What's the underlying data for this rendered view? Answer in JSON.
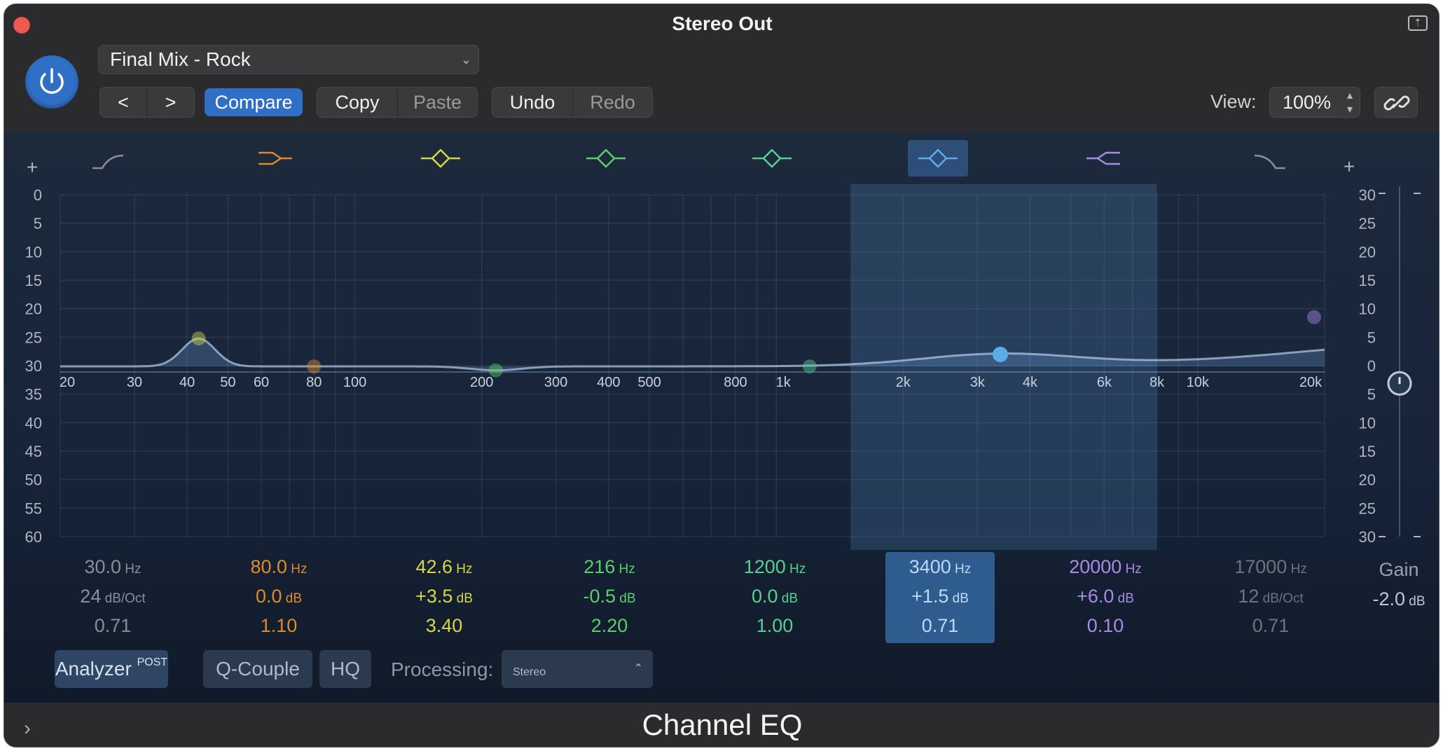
{
  "window": {
    "title": "Stereo Out",
    "plugin_name": "Channel EQ"
  },
  "header": {
    "preset": "Final Mix - Rock",
    "prev_label": "<",
    "next_label": ">",
    "compare_label": "Compare",
    "copy_label": "Copy",
    "paste_label": "Paste",
    "undo_label": "Undo",
    "redo_label": "Redo",
    "view_label": "View:",
    "view_value": "100%"
  },
  "graph": {
    "left_scale_plus": "+",
    "left_scale": [
      "0",
      "5",
      "10",
      "15",
      "20",
      "25",
      "30",
      "35",
      "40",
      "45",
      "50",
      "55",
      "60"
    ],
    "right_scale_plus": "+",
    "right_scale": [
      "30",
      "25",
      "20",
      "15",
      "10",
      "5",
      "0",
      "5",
      "10",
      "15",
      "20",
      "25",
      "30"
    ],
    "freq_labels": [
      "20",
      "30",
      "40",
      "50",
      "60",
      "80",
      "100",
      "200",
      "300",
      "400",
      "500",
      "800",
      "1k",
      "2k",
      "3k",
      "4k",
      "6k",
      "8k",
      "10k",
      "20k"
    ],
    "band_icons": [
      "highpass",
      "lowshelf",
      "peak",
      "peak",
      "peak",
      "peak",
      "highshelf",
      "lowpass"
    ],
    "colors": {
      "band1": "#8a8f96",
      "band2": "#e08a2c",
      "band3": "#d7d64a",
      "band4": "#5bcf6a",
      "band5": "#5bcf93",
      "band6": "#5aaee8",
      "band7": "#a98ae6",
      "band8": "#8a8f96"
    }
  },
  "bands": [
    {
      "freq": "30.0",
      "freq_unit": "Hz",
      "mid": "24",
      "mid_unit": "dB/Oct",
      "q": "0.71"
    },
    {
      "freq": "80.0",
      "freq_unit": "Hz",
      "mid": "0.0",
      "mid_unit": "dB",
      "q": "1.10"
    },
    {
      "freq": "42.6",
      "freq_unit": "Hz",
      "mid": "+3.5",
      "mid_unit": "dB",
      "q": "3.40"
    },
    {
      "freq": "216",
      "freq_unit": "Hz",
      "mid": "-0.5",
      "mid_unit": "dB",
      "q": "2.20"
    },
    {
      "freq": "1200",
      "freq_unit": "Hz",
      "mid": "0.0",
      "mid_unit": "dB",
      "q": "1.00"
    },
    {
      "freq": "3400",
      "freq_unit": "Hz",
      "mid": "+1.5",
      "mid_unit": "dB",
      "q": "0.71"
    },
    {
      "freq": "20000",
      "freq_unit": "Hz",
      "mid": "+6.0",
      "mid_unit": "dB",
      "q": "0.10"
    },
    {
      "freq": "17000",
      "freq_unit": "Hz",
      "mid": "12",
      "mid_unit": "dB/Oct",
      "q": "0.71"
    }
  ],
  "gain": {
    "label": "Gain",
    "value": "-2.0",
    "unit": "dB"
  },
  "controls": {
    "analyzer_label": "Analyzer",
    "analyzer_badge": "POST",
    "qcouple_label": "Q-Couple",
    "hq_label": "HQ",
    "processing_label": "Processing:",
    "processing_value": "Stereo"
  }
}
